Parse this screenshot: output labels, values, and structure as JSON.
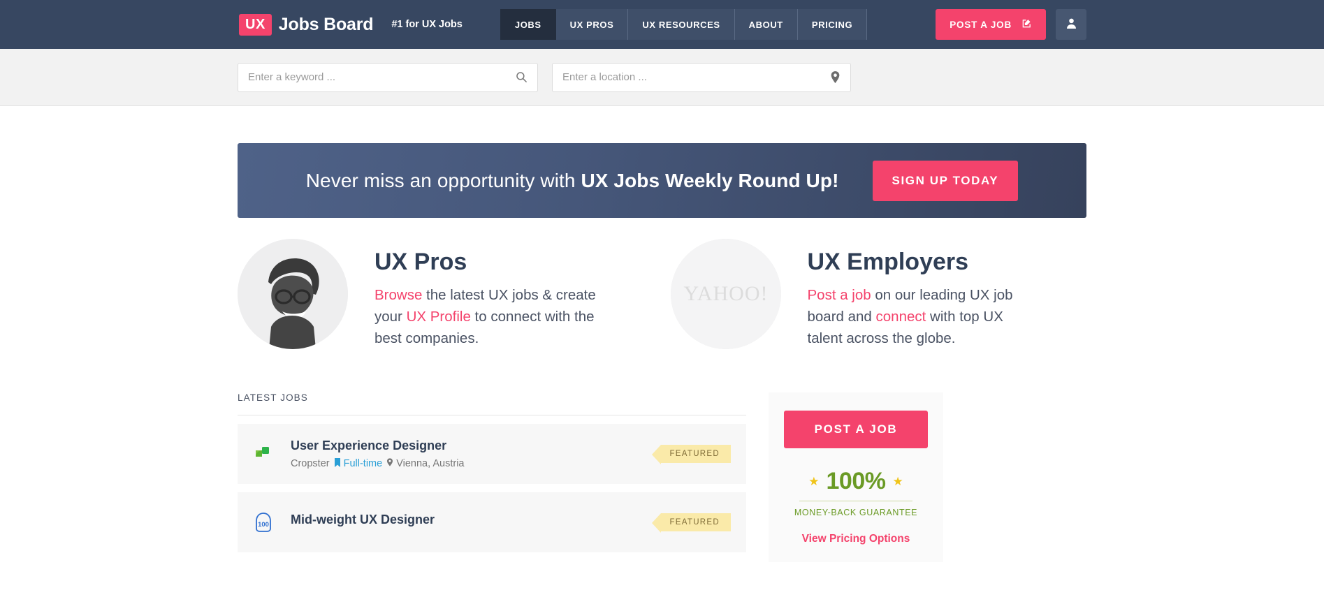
{
  "header": {
    "logo_badge": "UX",
    "brand_name": "Jobs Board",
    "tagline": "#1 for UX Jobs",
    "nav": [
      {
        "label": "JOBS",
        "active": true
      },
      {
        "label": "UX PROS",
        "active": false
      },
      {
        "label": "UX RESOURCES",
        "active": false
      },
      {
        "label": "ABOUT",
        "active": false
      },
      {
        "label": "PRICING",
        "active": false
      }
    ],
    "post_job_label": "POST A JOB",
    "post_job_icon": "edit-square-icon",
    "account_icon": "user-avatar-icon",
    "bg_color": "#374761",
    "accent_color": "#f4436c"
  },
  "search": {
    "keyword_placeholder": "Enter a keyword ...",
    "keyword_value": "",
    "keyword_icon": "search-icon",
    "location_placeholder": "Enter a location ...",
    "location_value": "",
    "location_icon": "map-pin-icon"
  },
  "promo": {
    "text_normal": "Never miss an opportunity with ",
    "text_bold": "UX Jobs Weekly Round Up!",
    "button_label": "SIGN UP TODAY"
  },
  "intro": {
    "pros": {
      "title": "UX Pros",
      "avatar_icon": "woman-photo-avatar",
      "link1": "Browse",
      "text1": " the latest UX jobs & create your ",
      "link2": "UX Profile",
      "text2": " to connect with the best companies."
    },
    "employers": {
      "title": "UX Employers",
      "logo_icon": "yahoo-logo-icon",
      "logo_text": "YAHOO!",
      "link1": "Post a job",
      "text1": " on our leading UX job board and ",
      "link2": "connect",
      "text2": " with top UX talent across the globe."
    }
  },
  "jobs": {
    "section_label": "LATEST JOBS",
    "items": [
      {
        "title": "User Experience Designer",
        "company": "Cropster",
        "type": "Full-time",
        "location": "Vienna, Austria",
        "badge": "FEATURED",
        "logo_icon": "cropster-green-leaf-logo",
        "logo_color": "#5cb531"
      },
      {
        "title": "Mid-weight UX Designer",
        "company": "",
        "type": "",
        "location": "",
        "badge": "FEATURED",
        "logo_icon": "hundred-blue-circle-logo",
        "logo_color": "#2f6fd0",
        "logo_text": "100"
      }
    ]
  },
  "sidebar": {
    "post_job_label": "POST A JOB",
    "guarantee_percent": "100%",
    "guarantee_label": "MONEY-BACK  GUARANTEE",
    "pricing_link": "View Pricing Options",
    "star_icon": "star-icon"
  }
}
